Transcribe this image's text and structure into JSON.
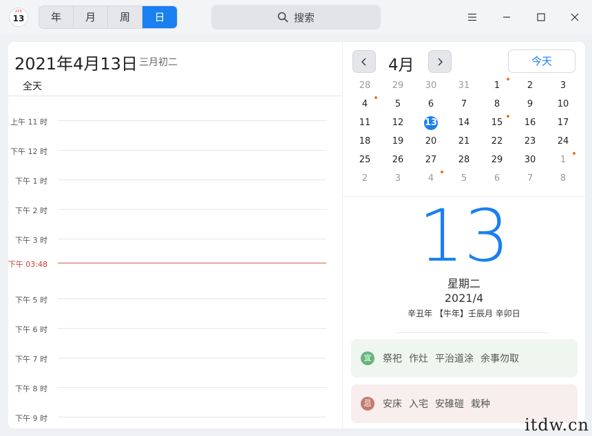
{
  "app": {
    "icon_month": "APR",
    "icon_day": "13"
  },
  "views": {
    "year": "年",
    "month": "月",
    "week": "周",
    "day": "日",
    "active": "day"
  },
  "search": {
    "label": "搜索"
  },
  "day_view": {
    "date_title": "2021年4月13日",
    "lunar": "三月初二",
    "all_day": "全天",
    "hours": [
      {
        "label": "上午 11 时",
        "current": false
      },
      {
        "label": "下午 12 时",
        "current": false
      },
      {
        "label": "下午 1 时",
        "current": false
      },
      {
        "label": "下午 2 时",
        "current": false
      },
      {
        "label": "下午 3 时",
        "current": false
      },
      {
        "label": "下午 03:48",
        "current": true
      },
      {
        "label": "下午 5 时",
        "current": false
      },
      {
        "label": "下午 6 时",
        "current": false
      },
      {
        "label": "下午 7 时",
        "current": false
      },
      {
        "label": "下午 8 时",
        "current": false
      },
      {
        "label": "下午 9 时",
        "current": false
      }
    ]
  },
  "mini_cal": {
    "month_title": "4月",
    "today_button": "今天",
    "days": [
      {
        "n": "28",
        "other": true,
        "dot": false
      },
      {
        "n": "29",
        "other": true,
        "dot": false
      },
      {
        "n": "30",
        "other": true,
        "dot": false
      },
      {
        "n": "31",
        "other": true,
        "dot": false
      },
      {
        "n": "1",
        "other": false,
        "dot": true
      },
      {
        "n": "2",
        "other": false,
        "dot": false
      },
      {
        "n": "3",
        "other": false,
        "dot": false
      },
      {
        "n": "4",
        "other": false,
        "dot": true
      },
      {
        "n": "5",
        "other": false,
        "dot": false
      },
      {
        "n": "6",
        "other": false,
        "dot": false
      },
      {
        "n": "7",
        "other": false,
        "dot": false
      },
      {
        "n": "8",
        "other": false,
        "dot": false
      },
      {
        "n": "9",
        "other": false,
        "dot": false
      },
      {
        "n": "10",
        "other": false,
        "dot": false
      },
      {
        "n": "11",
        "other": false,
        "dot": false
      },
      {
        "n": "12",
        "other": false,
        "dot": false
      },
      {
        "n": "13",
        "other": false,
        "dot": false,
        "selected": true
      },
      {
        "n": "14",
        "other": false,
        "dot": false
      },
      {
        "n": "15",
        "other": false,
        "dot": true
      },
      {
        "n": "16",
        "other": false,
        "dot": false
      },
      {
        "n": "17",
        "other": false,
        "dot": false
      },
      {
        "n": "18",
        "other": false,
        "dot": false
      },
      {
        "n": "19",
        "other": false,
        "dot": false
      },
      {
        "n": "20",
        "other": false,
        "dot": false
      },
      {
        "n": "21",
        "other": false,
        "dot": false
      },
      {
        "n": "22",
        "other": false,
        "dot": false
      },
      {
        "n": "23",
        "other": false,
        "dot": false
      },
      {
        "n": "24",
        "other": false,
        "dot": false
      },
      {
        "n": "25",
        "other": false,
        "dot": false
      },
      {
        "n": "26",
        "other": false,
        "dot": false
      },
      {
        "n": "27",
        "other": false,
        "dot": false
      },
      {
        "n": "28",
        "other": false,
        "dot": false
      },
      {
        "n": "29",
        "other": false,
        "dot": false
      },
      {
        "n": "30",
        "other": false,
        "dot": false
      },
      {
        "n": "1",
        "other": true,
        "dot": true
      },
      {
        "n": "2",
        "other": true,
        "dot": false
      },
      {
        "n": "3",
        "other": true,
        "dot": false
      },
      {
        "n": "4",
        "other": true,
        "dot": true
      },
      {
        "n": "5",
        "other": true,
        "dot": false
      },
      {
        "n": "6",
        "other": true,
        "dot": false
      },
      {
        "n": "7",
        "other": true,
        "dot": false
      },
      {
        "n": "8",
        "other": true,
        "dot": false
      }
    ]
  },
  "detail": {
    "big_day": "13",
    "weekday": "星期二",
    "year_month": "2021/4",
    "ganzhi": "辛丑年 【牛年】壬辰月 辛卯日",
    "yi_badge": "宜",
    "yi_items": [
      "祭祀",
      "作灶",
      "平治道涂",
      "余事勿取"
    ],
    "ji_badge": "忌",
    "ji_items": [
      "安床",
      "入宅",
      "安碓磑",
      "栽种"
    ]
  },
  "watermark": "itdw.cn",
  "colors": {
    "accent": "#1a7ff0",
    "event_dot": "#e8741c",
    "current_time": "#d9534f",
    "yi_badge": "#66b57a",
    "ji_badge": "#c47b6f"
  }
}
